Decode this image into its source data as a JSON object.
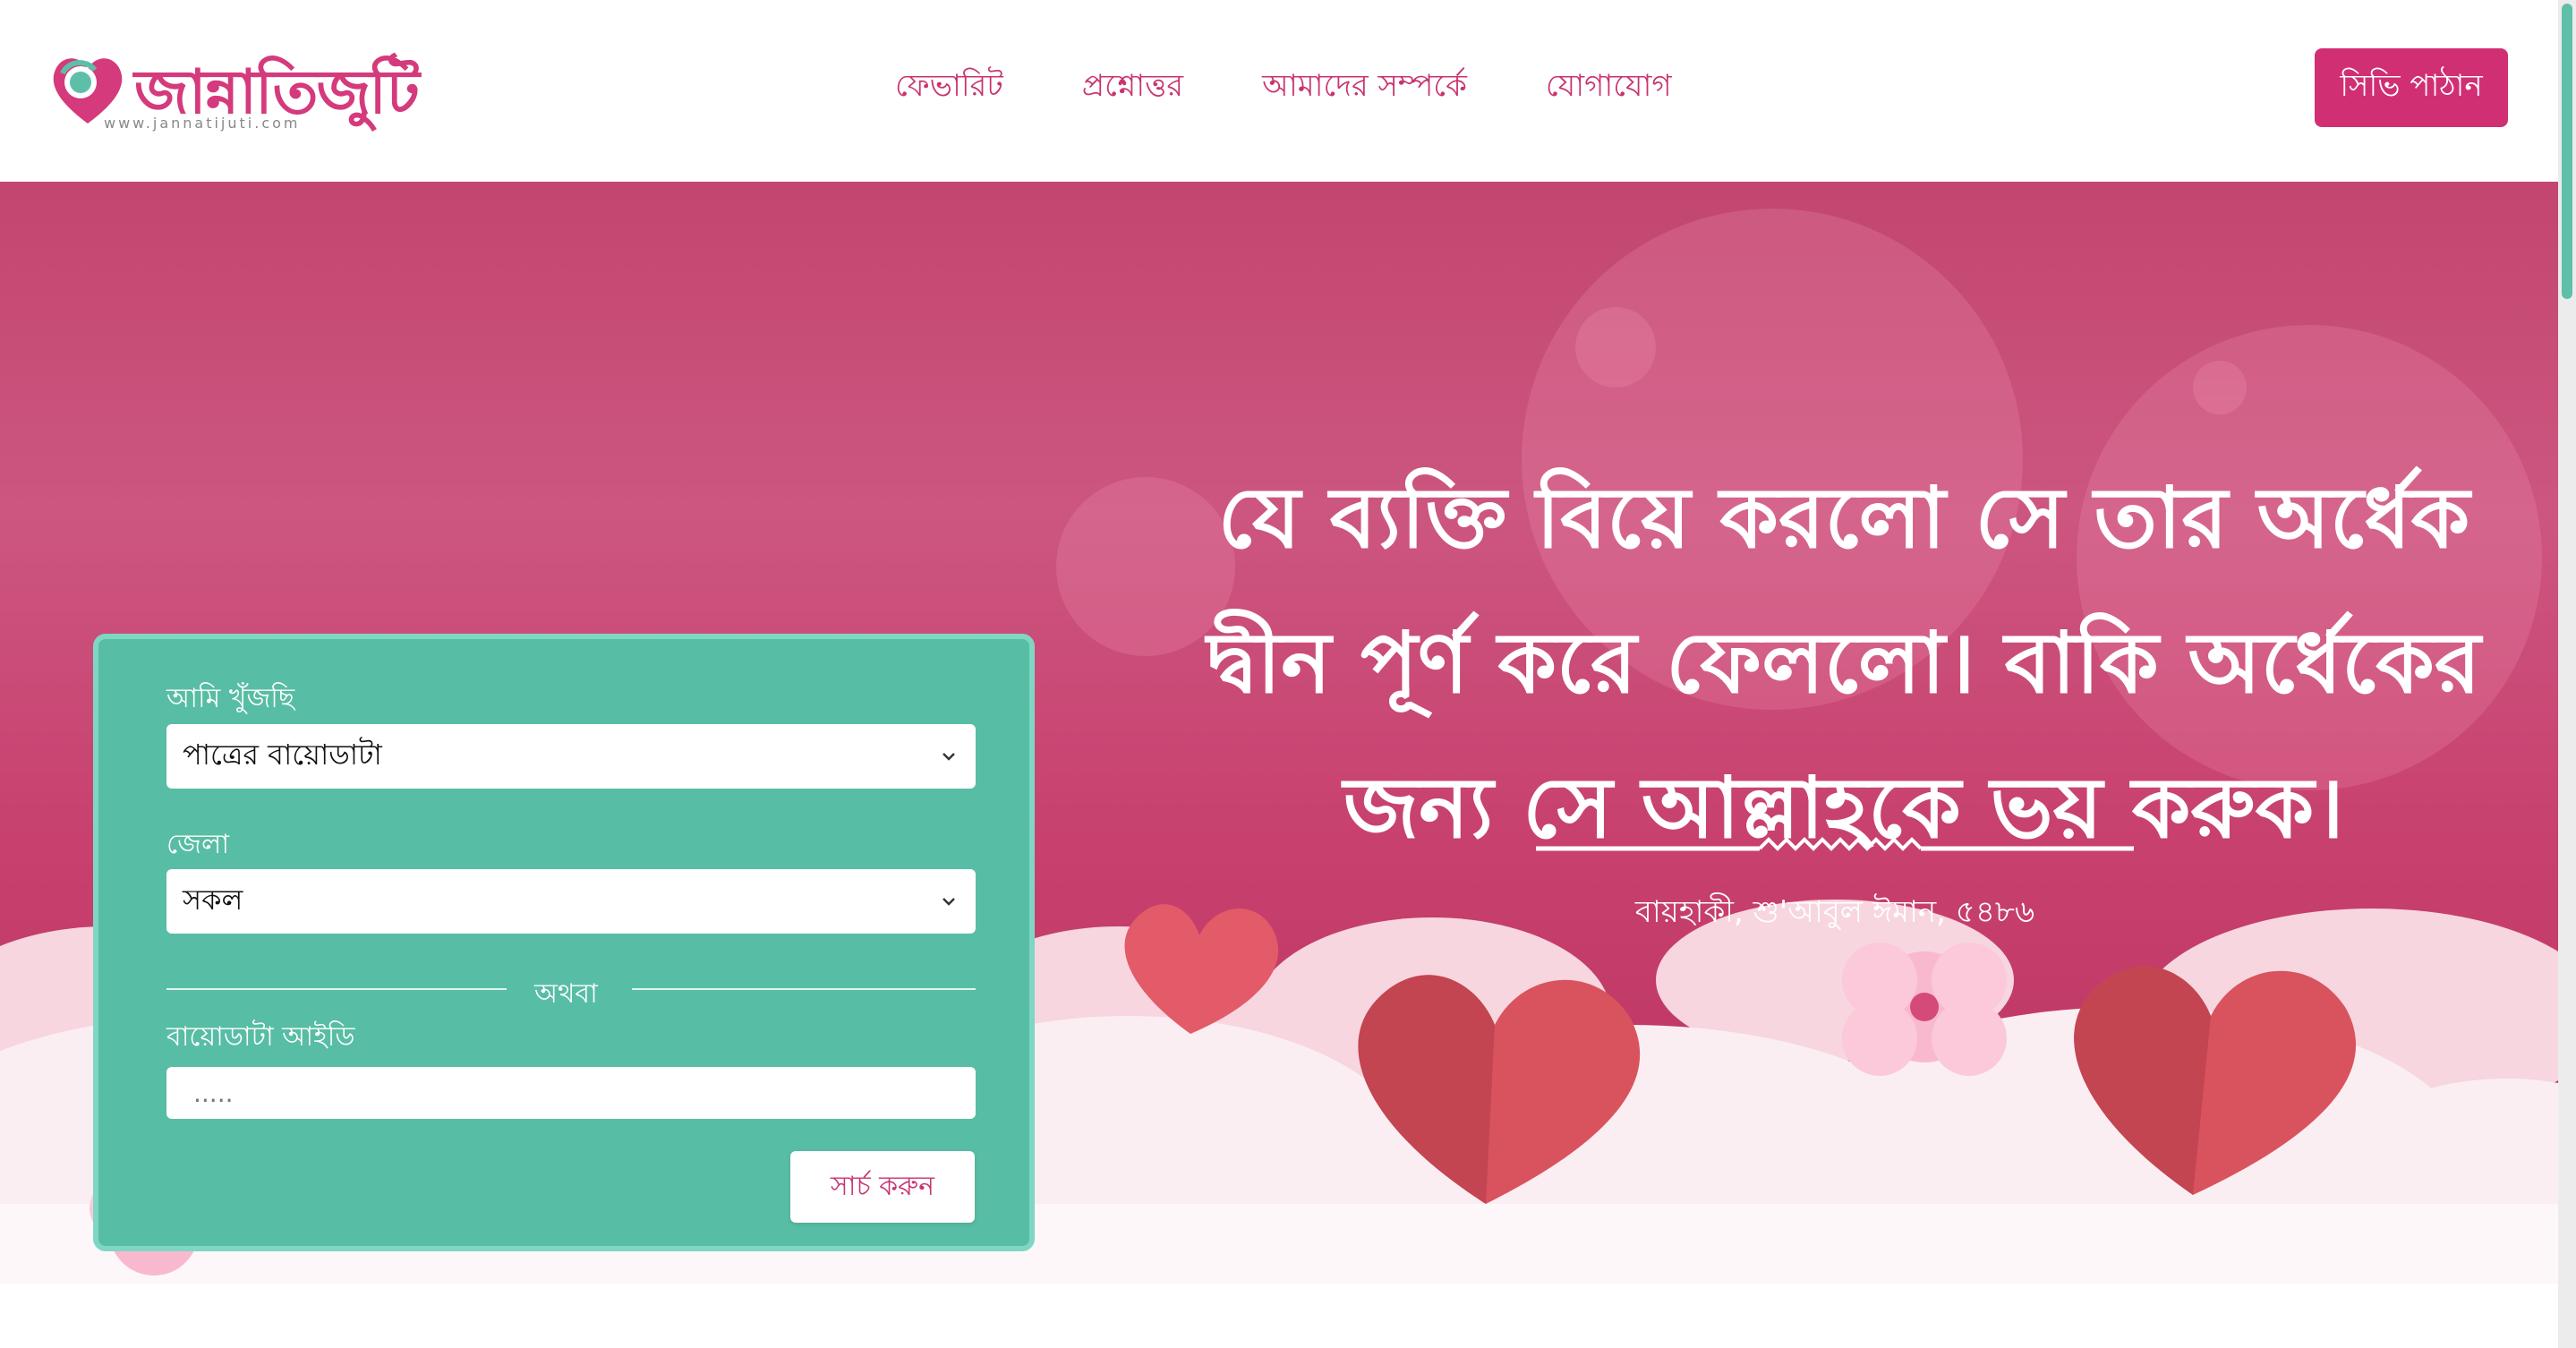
{
  "brand": {
    "logo_text": "জান্নাতিজুটি",
    "logo_url": "www.jannatijuti.com"
  },
  "nav": {
    "items": [
      {
        "label": "ফেভারিট"
      },
      {
        "label": "প্রশ্নোত্তর"
      },
      {
        "label": "আমাদের সম্পর্কে"
      },
      {
        "label": "যোগাযোগ"
      }
    ],
    "cta_label": "সিভি পাঠান"
  },
  "search": {
    "looking_for_label": "আমি খুঁজছি",
    "looking_for_value": "পাত্রের বায়োডাটা",
    "district_label": "জেলা",
    "district_value": "সকল",
    "or_label": "অথবা",
    "biodata_id_label": "বায়োডাটা আইডি",
    "biodata_id_placeholder": ".....",
    "search_button_label": "সার্চ করুন"
  },
  "quote": {
    "lines": [
      "যে ব্যক্তি বিয়ে করলো সে তার অর্ধেক",
      "দ্বীন পূর্ণ করে ফেললো। বাকি অর্ধেকের",
      "জন্য সে আল্লাহকে ভয় করুক।"
    ],
    "source": "বায়হাকী, শু'আবুল ঈমান, ৫৪৮৬"
  },
  "colors": {
    "accent_pink": "#d12f73",
    "nav_pink": "#c8336f",
    "panel_teal": "#58bda5",
    "hero_pink": "#c8406e"
  },
  "icons": [
    "heart-logo-icon",
    "chevron-down-icon",
    "heart-decoration",
    "flower-decoration"
  ]
}
